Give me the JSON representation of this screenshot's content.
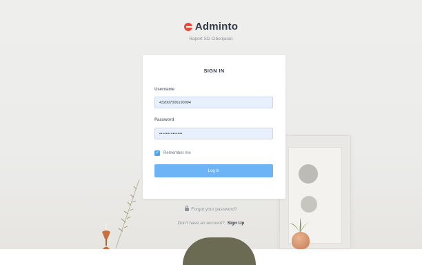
{
  "brand": {
    "name": "Adminto",
    "subtitle": "Raport SD Cibonjaran"
  },
  "card": {
    "title": "SIGN IN",
    "username": {
      "label": "Username",
      "value": "432007006190094"
    },
    "password": {
      "label": "Password",
      "value": "••••••••••••••"
    },
    "remember": {
      "label": "Remember me",
      "checked": true
    },
    "login_label": "Log In"
  },
  "footer": {
    "forgot_label": "Forgot your password?",
    "no_account_text": "Don't have an account?",
    "signup_label": "Sign Up"
  },
  "colors": {
    "primary": "#6cb4f5",
    "brand_red": "#e84a3c",
    "text_dark": "#323a46",
    "muted": "#8d939b",
    "input_bg": "#e8f0fe"
  }
}
